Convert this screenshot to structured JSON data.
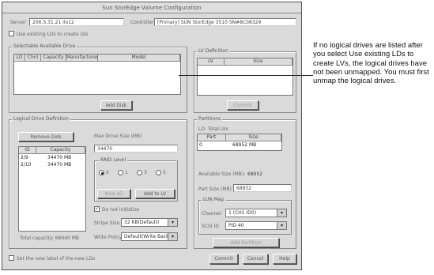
{
  "window": {
    "title": "Sun StorEdge Volume Configuration"
  },
  "header": {
    "server_label": "Server",
    "server_value": "206.5.31.21 ilo12",
    "controller_label": "Controller",
    "controller_value": "[Primary] SUN StorEdge 3510 SN#8C08329",
    "use_existing_label": "Use existing LDs to create LVs"
  },
  "selectable_drives": {
    "title": "Selectable Available Drive",
    "columns": [
      "LD",
      "Chnl",
      "Capacity",
      "Manufacturer",
      "Model"
    ],
    "add_button": "Add Disk"
  },
  "lv_definition": {
    "title": "LV Definition",
    "columns": [
      "LV",
      "Size"
    ],
    "commit_button": "Commit"
  },
  "ld_definition": {
    "title": "Logical Drive Definition",
    "remove_button": "Remove Disk",
    "columns": [
      "ID",
      "Capacity"
    ],
    "rows": [
      {
        "id": "2/9",
        "capacity": "34470 MB"
      },
      {
        "id": "2/10",
        "capacity": "34470 MB"
      }
    ],
    "available": "Total capacity: 68940 MB",
    "max_size_label": "Max Drive Size (MB)",
    "max_size_value": "34470",
    "raid_level_label": "RAID Level",
    "raid_options": [
      "0",
      "1",
      "3",
      "5"
    ],
    "raid_selected": "0",
    "new_ld_button": "New LD",
    "add_lv_button": "Add to LV",
    "write_policy_checkbox": "Do not initialize",
    "stripe_size_label": "Stripe Size",
    "stripe_size_value": "32 KB(Default)",
    "write_policy_label": "Write Policy",
    "write_policy_value": "Default(Write Back)"
  },
  "partitions": {
    "title": "Partitions",
    "ld_label": "LD: Total LVs",
    "columns": [
      "Part",
      "Size"
    ],
    "rows": [
      {
        "part": "0",
        "size": "68952 MB"
      }
    ],
    "available_label": "Available Size (MB):",
    "available_value": "68952",
    "part_size_label": "Part Size (MB)",
    "part_size_value": "68952",
    "map_title": "LUN Map",
    "channel_label": "Channel",
    "channel_value": "1 (CH1 ID0)",
    "scsi_label": "SCSI ID",
    "scsi_value": "PID 40",
    "add_partition_button": "Add Partition"
  },
  "footer": {
    "checkbox_label": "Set the new label of the new LDs",
    "commit_button": "Commit",
    "cancel_button": "Cancel",
    "help_button": "Help"
  },
  "annotation": {
    "text": "If no logical drives are listed after you select Use existing LDs to create LVs, the logical drives have not been unmapped. You must first unmap the logical drives."
  }
}
